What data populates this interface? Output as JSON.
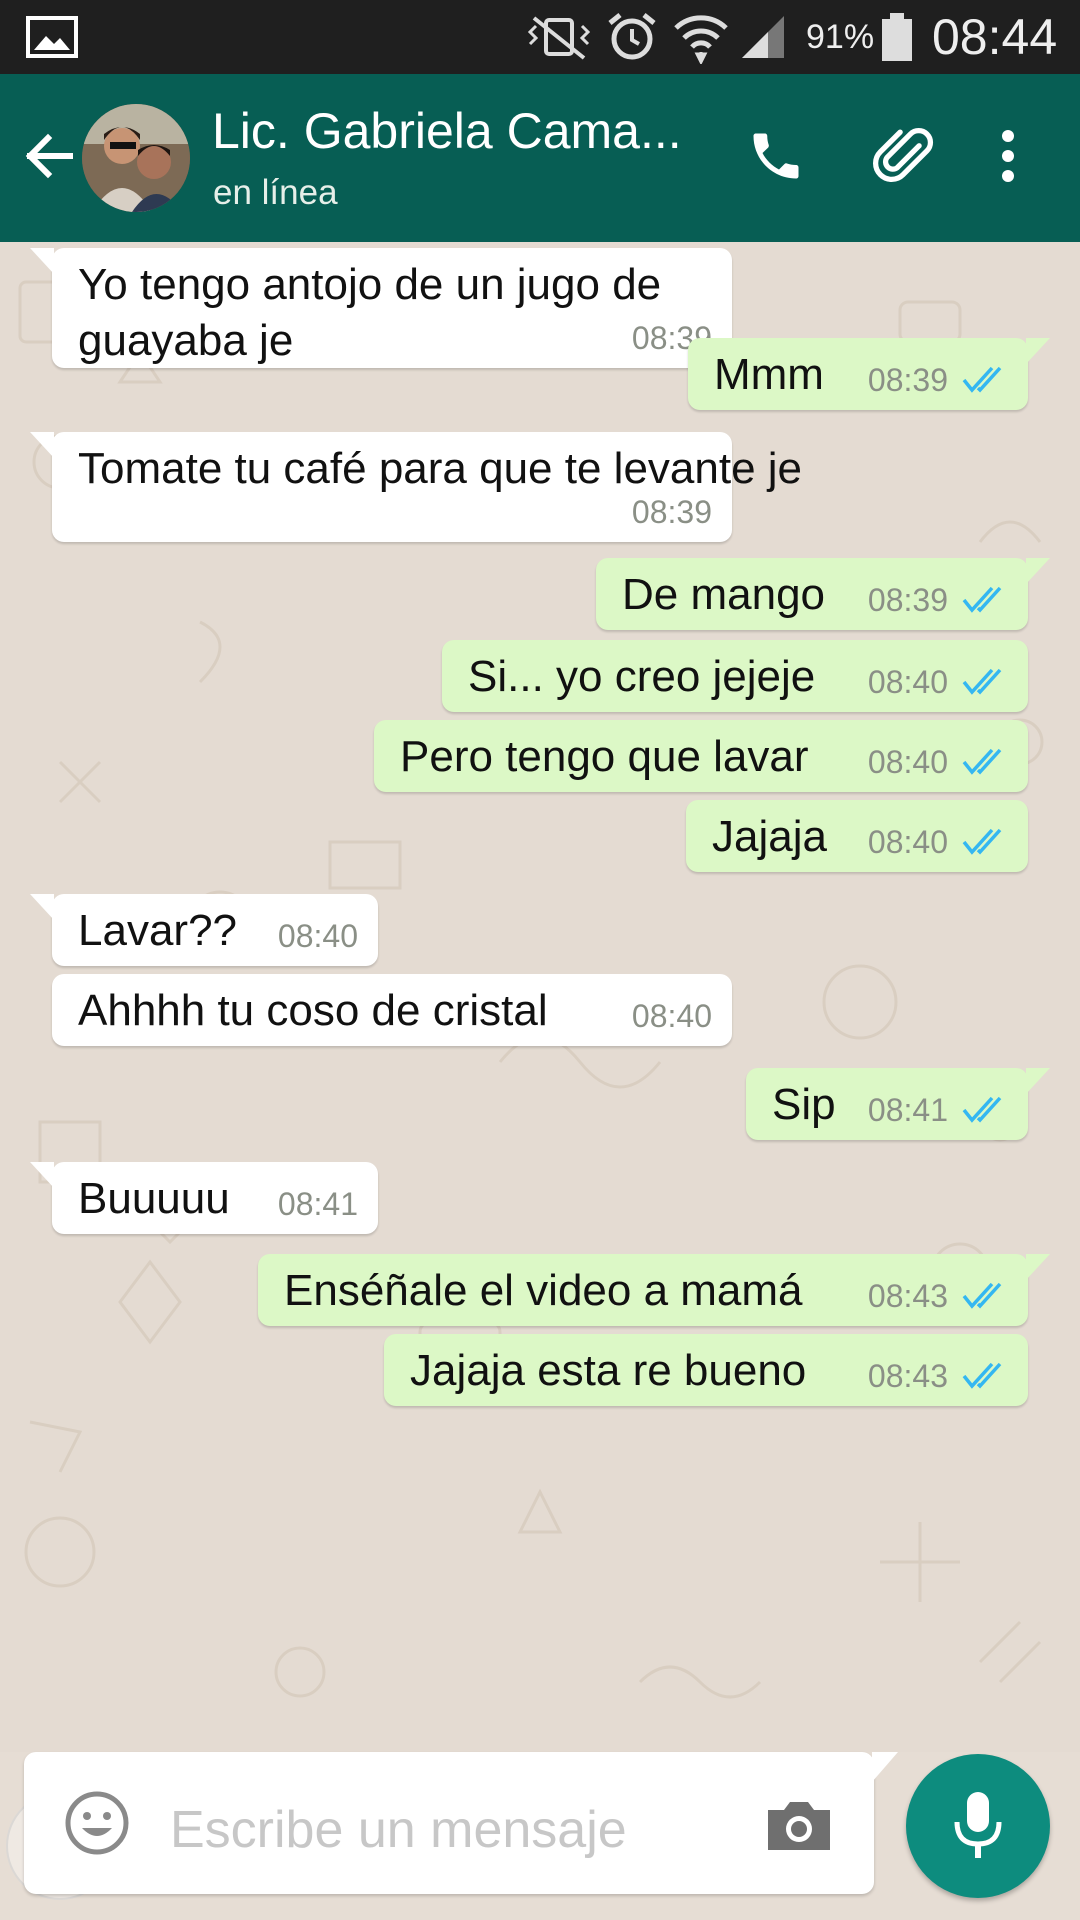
{
  "status_bar": {
    "battery_percent": "91%",
    "time": "08:44",
    "icons": [
      "gallery-icon",
      "vibrate-muted-icon",
      "alarm-icon",
      "wifi-icon",
      "signal-icon",
      "battery-icon"
    ]
  },
  "header": {
    "contact_name": "Lic. Gabriela Cama...",
    "status": "en línea",
    "icons": [
      "back-arrow-icon",
      "phone-icon",
      "paperclip-icon",
      "more-vert-icon"
    ]
  },
  "messages": [
    {
      "dir": "in",
      "lines": [
        "Yo tengo antojo de un jugo de",
        "guayaba je"
      ],
      "time": "08:39"
    },
    {
      "dir": "out",
      "lines": [
        "Mmm"
      ],
      "time": "08:39",
      "read": true
    },
    {
      "dir": "in",
      "lines": [
        "Tomate tu café para que te levante je"
      ],
      "time": "08:39"
    },
    {
      "dir": "out",
      "lines": [
        "De mango"
      ],
      "time": "08:39",
      "read": true
    },
    {
      "dir": "out",
      "lines": [
        "Si... yo creo jejeje"
      ],
      "time": "08:40",
      "read": true
    },
    {
      "dir": "out",
      "lines": [
        "Pero tengo que lavar"
      ],
      "time": "08:40",
      "read": true
    },
    {
      "dir": "out",
      "lines": [
        "Jajaja"
      ],
      "time": "08:40",
      "read": true
    },
    {
      "dir": "in",
      "lines": [
        "Lavar??"
      ],
      "time": "08:40"
    },
    {
      "dir": "in",
      "lines": [
        "Ahhhh tu coso de cristal"
      ],
      "time": "08:40"
    },
    {
      "dir": "out",
      "lines": [
        "Sip"
      ],
      "time": "08:41",
      "read": true
    },
    {
      "dir": "in",
      "lines": [
        "Buuuuu"
      ],
      "time": "08:41"
    },
    {
      "dir": "out",
      "lines": [
        "Enséñale el video a mamá"
      ],
      "time": "08:43",
      "read": true
    },
    {
      "dir": "out",
      "lines": [
        "Jajaja esta re bueno"
      ],
      "time": "08:43",
      "read": true
    }
  ],
  "composer": {
    "placeholder": "Escribe un mensaje",
    "icons": [
      "emoji-icon",
      "camera-icon",
      "mic-icon"
    ]
  },
  "colors": {
    "header_bg": "#075e54",
    "status_bar_bg": "#1f1f1f",
    "incoming_bubble": "#ffffff",
    "outgoing_bubble": "#dcf8c6",
    "read_ticks": "#34b7f1",
    "mic_button": "#0d8c7e"
  }
}
